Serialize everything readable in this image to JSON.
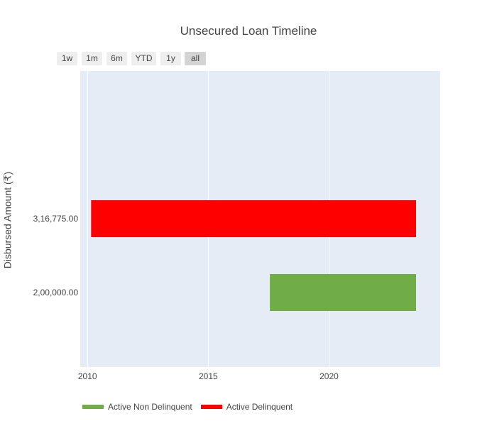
{
  "chart_data": {
    "type": "timeline",
    "title": "Unsecured Loan Timeline",
    "xlabel": "",
    "ylabel": "Disbursed Amount (₹)",
    "xlim": [
      2009.7,
      2024.6
    ],
    "x_ticks": [
      2010,
      2015,
      2020
    ],
    "categories": [
      "2,00,000.00",
      "3,16,775.00"
    ],
    "series": [
      {
        "name": "Active Non Delinquent",
        "color": "#70ad47",
        "bars": [
          {
            "category": "2,00,000.00",
            "start": 2017.55,
            "end": 2023.6
          }
        ]
      },
      {
        "name": "Active Delinquent",
        "color": "#ff0000",
        "bars": [
          {
            "category": "3,16,775.00",
            "start": 2010.15,
            "end": 2023.6
          }
        ]
      }
    ],
    "grid": true,
    "legend_position": "bottom-left"
  },
  "range_selector": {
    "buttons": [
      "1w",
      "1m",
      "6m",
      "YTD",
      "1y",
      "all"
    ],
    "active": "all"
  },
  "colors": {
    "plot_bg": "#e5ecf6",
    "grid": "#ffffff",
    "text": "#444444"
  }
}
